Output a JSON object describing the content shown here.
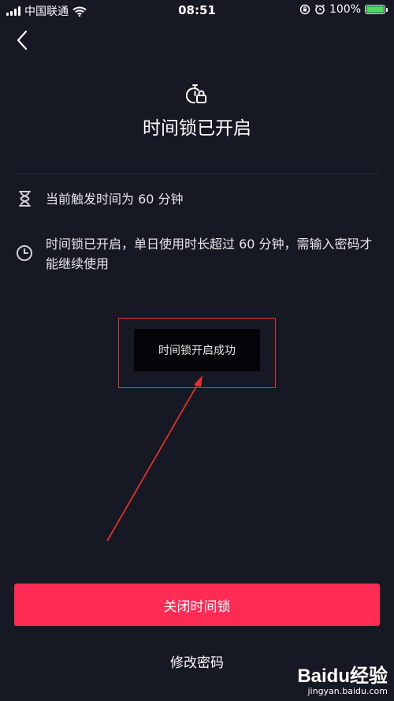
{
  "status_bar": {
    "carrier": "中国联通",
    "time": "08:51",
    "battery": "100%",
    "battery_level": 1.0
  },
  "page": {
    "title": "时间锁已开启"
  },
  "info": {
    "trigger_text": "当前触发时间为 60 分钟",
    "description": "时间锁已开启，单日使用时长超过 60 分钟，需输入密码才能继续使用"
  },
  "toast": {
    "message": "时间锁开启成功"
  },
  "actions": {
    "primary_label": "关闭时间锁",
    "secondary_label": "修改密码"
  },
  "watermark": {
    "brand": "Baidu",
    "brand_suffix": "经验",
    "url": "jingyan.baidu.com"
  },
  "colors": {
    "background": "#161823",
    "accent": "#fe2c55",
    "annotation": "#e0312c",
    "battery": "#4cd964"
  }
}
